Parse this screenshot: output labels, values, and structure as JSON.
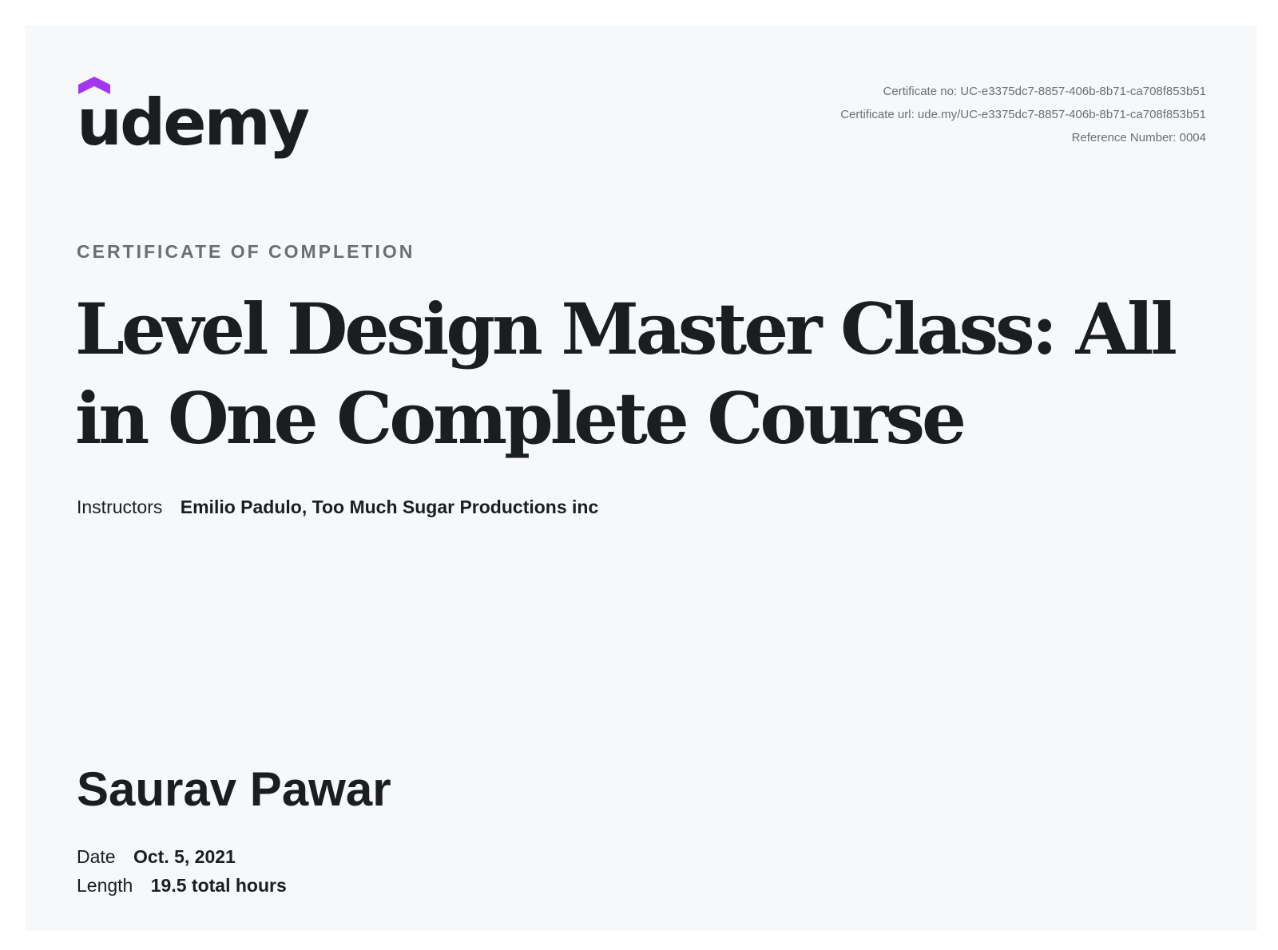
{
  "brand": {
    "logo_text": "udemy",
    "accent_color": "#a435f0",
    "text_color": "#1c1d1f",
    "muted_color": "#6a6f73",
    "background_color": "#f7f8fa"
  },
  "meta": {
    "certificate_no": "Certificate no: UC-e3375dc7-8857-406b-8b71-ca708f853b51",
    "certificate_url": "Certificate url: ude.my/UC-e3375dc7-8857-406b-8b71-ca708f853b51",
    "reference_number": "Reference Number: 0004"
  },
  "certificate": {
    "eyebrow": "CERTIFICATE OF COMPLETION",
    "course_title": "Level Design Master Class: All in One Complete Course",
    "instructors_label": "Instructors",
    "instructors": "Emilio Padulo,  Too Much Sugar Productions inc",
    "student_name": "Saurav Pawar",
    "date_label": "Date",
    "date_value": "Oct. 5, 2021",
    "length_label": "Length",
    "length_value": "19.5 total hours"
  }
}
